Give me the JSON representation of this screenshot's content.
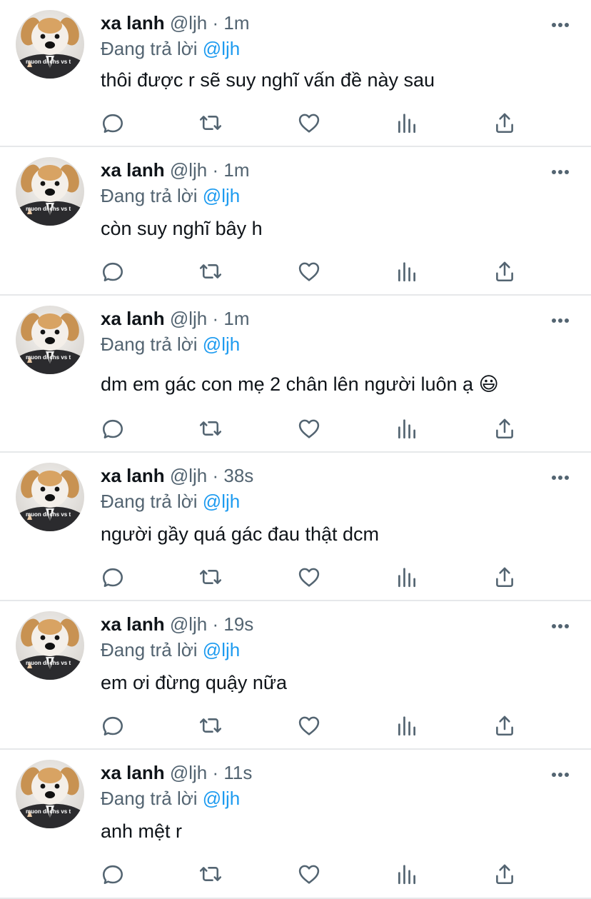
{
  "tweets": [
    {
      "name": "xa lanh",
      "handle": "@ljh",
      "separator": "·",
      "time": "1m",
      "reply_prefix": "Đang trả lời",
      "reply_to": "@ljh",
      "text": "thôi được r sẽ suy nghĩ vấn đề này sau",
      "avatar_caption": "muon di chs vs t"
    },
    {
      "name": "xa lanh",
      "handle": "@ljh",
      "separator": "·",
      "time": "1m",
      "reply_prefix": "Đang trả lời",
      "reply_to": "@ljh",
      "text": "còn suy nghĩ bây h",
      "avatar_caption": "muon di chs vs t"
    },
    {
      "name": "xa lanh",
      "handle": "@ljh",
      "separator": "·",
      "time": "1m",
      "reply_prefix": "Đang trả lời",
      "reply_to": "@ljh",
      "text": "dm em gác con mẹ 2 chân lên người luôn ạ 😃",
      "avatar_caption": "muon di chs vs t"
    },
    {
      "name": "xa lanh",
      "handle": "@ljh",
      "separator": "·",
      "time": "38s",
      "reply_prefix": "Đang trả lời",
      "reply_to": "@ljh",
      "text": "người gầy quá gác đau thật dcm",
      "avatar_caption": "muon di chs vs t"
    },
    {
      "name": "xa lanh",
      "handle": "@ljh",
      "separator": "·",
      "time": "19s",
      "reply_prefix": "Đang trả lời",
      "reply_to": "@ljh",
      "text": "em ơi đừng quậy nữa",
      "avatar_caption": "muon di chs vs t"
    },
    {
      "name": "xa lanh",
      "handle": "@ljh",
      "separator": "·",
      "time": "11s",
      "reply_prefix": "Đang trả lời",
      "reply_to": "@ljh",
      "text": "anh mệt r",
      "avatar_caption": "muon di chs vs t"
    }
  ],
  "icons": {
    "more": "more-horizontal-icon",
    "reply": "reply-icon",
    "retweet": "retweet-icon",
    "like": "heart-icon",
    "views": "views-chart-icon",
    "share": "share-icon"
  },
  "colors": {
    "text": "#0f1419",
    "secondary": "#536471",
    "mention": "#1d9bf0",
    "divider": "#e6e8ea"
  }
}
